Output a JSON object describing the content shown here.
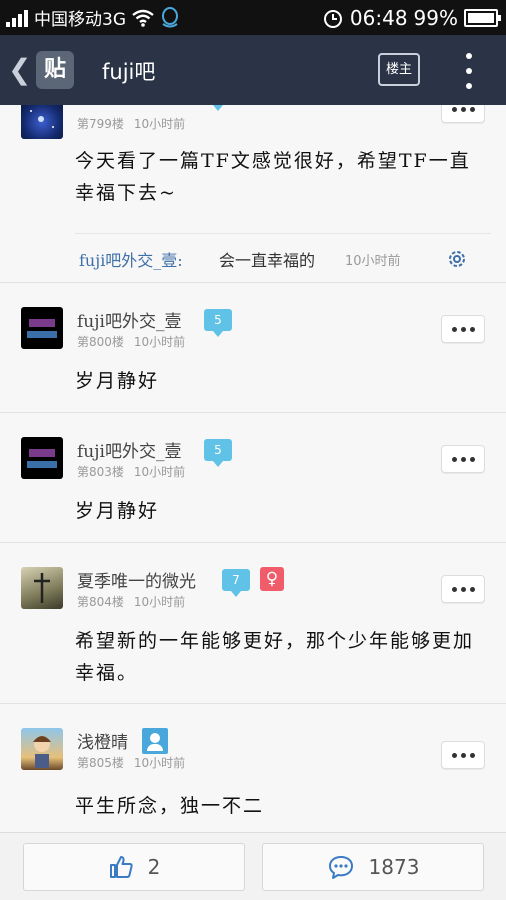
{
  "status_bar": {
    "carrier": "中国移动3G",
    "time": "06:48",
    "battery": "99%",
    "battery_level": 0.99,
    "icons": [
      "signal-icon",
      "wifi-icon",
      "qq-icon",
      "alarm-icon",
      "battery-icon"
    ]
  },
  "nav": {
    "logo": "贴",
    "title": "fuji吧",
    "owner_label": "楼主"
  },
  "posts": [
    {
      "username": "",
      "floor": "第799楼",
      "time": "10小时前",
      "text": "今天看了一篇TF文感觉很好，希望TF一直幸福下去~",
      "reply": {
        "name": "fuji吧外交_壹:",
        "text": "会一直幸福的",
        "time": "10小时前"
      }
    },
    {
      "username": "fuji吧外交_壹",
      "level": "5",
      "floor": "第800楼",
      "time": "10小时前",
      "text": "岁月静好"
    },
    {
      "username": "fuji吧外交_壹",
      "level": "5",
      "floor": "第803楼",
      "time": "10小时前",
      "text": "岁月静好"
    },
    {
      "username": "夏季唯一的微光",
      "level": "7",
      "gender": "♀",
      "floor": "第804楼",
      "time": "10小时前",
      "text": "希望新的一年能够更好，那个少年能够更加幸福。"
    },
    {
      "username": "浅橙晴",
      "floor": "第805楼",
      "time": "10小时前",
      "text": "平生所念，独一不二"
    }
  ],
  "bottom": {
    "likes": "2",
    "comments": "1873"
  },
  "colors": {
    "nav_bg": "#2b3446",
    "level_badge": "#5fc2e6",
    "female_badge": "#f05c6a",
    "reply_name": "#3e6fa8"
  }
}
